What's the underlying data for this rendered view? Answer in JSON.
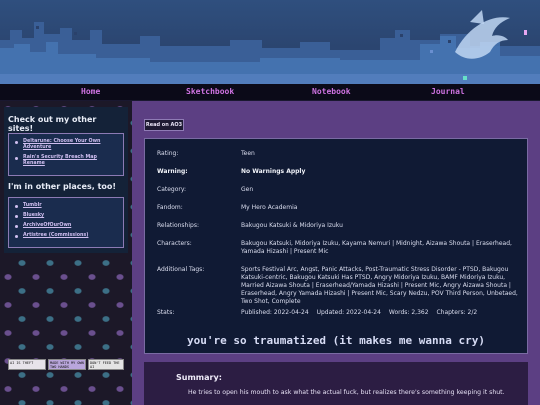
{
  "nav": {
    "items": [
      "Home",
      "Sketchbook",
      "Notebook",
      "Journal"
    ]
  },
  "sidebar": {
    "other_sites_heading": "Check out my other sites!",
    "other_sites": [
      "Deltarune: Choose Your Own Adventure",
      "Rain's Security Breach Map Rename"
    ],
    "elsewhere_heading": "I'm in other places, too!",
    "elsewhere": [
      "Tumblr",
      "Bluesky",
      "ArchiveOfOurOwn",
      "Artistree (Commissions)"
    ],
    "badges": [
      "AI IS THEFT",
      "MADE WITH MY OWN TWO HANDS",
      "DON'T FEED THE AI"
    ]
  },
  "main": {
    "read_on_ao3": "Read on AO3",
    "meta": {
      "rating_label": "Rating:",
      "rating": "Teen",
      "warning_label": "Warning:",
      "warning": "No Warnings Apply",
      "category_label": "Category:",
      "category": "Gen",
      "fandom_label": "Fandom:",
      "fandom": "My Hero Academia",
      "relationships_label": "Relationships:",
      "relationships": "Bakugou Katsuki & Midoriya Izuku",
      "characters_label": "Characters:",
      "characters": "Bakugou Katsuki, Midoriya Izuku, Kayama Nemuri | Midnight, Aizawa Shouta | Eraserhead, Yamada Hizashi | Present Mic",
      "tags_label": "Additional Tags:",
      "tags": "Sports Festival Arc, Angst, Panic Attacks, Post-Traumatic Stress Disorder - PTSD, Bakugou Katsuki-centric, Bakugou Katsuki Has PTSD, Angry Midoriya Izuku, BAMF Midoriya Izuku, Married Aizawa Shouta | Eraserhead/Yamada Hizashi | Present Mic, Angry Aizawa Shouta | Eraserhead, Angry Yamada Hizashi | Present Mic, Scary Nedzu, POV Third Person, Unbetaed, Two Shot, Complete",
      "stats_label": "Stats:",
      "published": "Published: 2022-04-24",
      "updated": "Updated: 2022-04-24",
      "words": "Words: 2,362",
      "chapters": "Chapters: 2/2"
    },
    "title": "you're so traumatized (it makes me wanna cry)",
    "summary_heading": "Summary:",
    "summary": "He tries to open his mouth to ask what the actual fuck, but realizes there's something keeping it shut."
  }
}
